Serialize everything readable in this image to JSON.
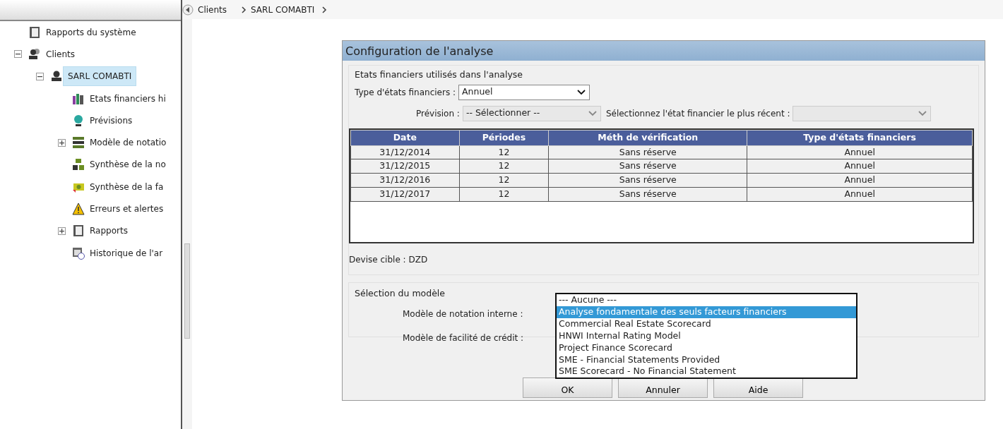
{
  "tree": [
    {
      "label": "Rapports du système",
      "selected": false
    },
    {
      "label": "Clients",
      "selected": false,
      "expanded": true,
      "children": [
        {
          "label": "SARL COMABTI",
          "selected": true,
          "expanded": true,
          "children": [
            {
              "label": "Etats financiers hi",
              "selected": false
            },
            {
              "label": "Prévisions",
              "selected": false
            },
            {
              "label": "Modèle de notatio",
              "selected": false,
              "expanded": false
            },
            {
              "label": "Synthèse de la no",
              "selected": false
            },
            {
              "label": "Synthèse de la fa",
              "selected": false
            },
            {
              "label": "Erreurs et alertes",
              "selected": false
            },
            {
              "label": "Rapports",
              "selected": false,
              "expanded": false
            },
            {
              "label": "Historique de l'ar",
              "selected": false
            }
          ]
        }
      ]
    }
  ],
  "breadcrumb": [
    "Clients",
    "SARL COMABTI"
  ],
  "dialog": {
    "title": "Configuration de l'analyse",
    "statements_section": {
      "legend": "Etats financiers utilisés dans l'analyse",
      "type_label": "Type d'états financiers :",
      "type_value": "Annuel",
      "forecast_label": "Prévision :",
      "forecast_value": "-- Sélectionner --",
      "forecast_disabled": true,
      "recent_label": "Sélectionnez l'état financier le plus récent :",
      "recent_disabled": true,
      "table": {
        "columns": [
          "Date",
          "Périodes",
          "Méth de vérification",
          "Type d'états financiers"
        ],
        "rows": [
          [
            "31/12/2014",
            "12",
            "Sans réserve",
            "Annuel"
          ],
          [
            "31/12/2015",
            "12",
            "Sans réserve",
            "Annuel"
          ],
          [
            "31/12/2016",
            "12",
            "Sans réserve",
            "Annuel"
          ],
          [
            "31/12/2017",
            "12",
            "Sans réserve",
            "Annuel"
          ]
        ]
      },
      "currency": "Devise cible : DZD"
    },
    "model_section": {
      "legend": "Sélection du modèle",
      "labels": [
        "Modèle de notation interne :",
        "Modèle de facilité de crédit :"
      ],
      "open_list": [
        {
          "text": "--- Aucune ---",
          "selected": false
        },
        {
          "text": "Analyse fondamentale des seuls facteurs financiers",
          "selected": true
        },
        {
          "text": "Commercial Real Estate Scorecard",
          "selected": false
        },
        {
          "text": "HNWI Internal Rating Model",
          "selected": false
        },
        {
          "text": "Project Finance Scorecard",
          "selected": false
        },
        {
          "text": "SME - Financial Statements Provided",
          "selected": false
        },
        {
          "text": "SME Scorecard - No Financial Statement",
          "selected": false
        }
      ]
    },
    "buttons": [
      "OK",
      "Annuler",
      "Aide"
    ]
  }
}
